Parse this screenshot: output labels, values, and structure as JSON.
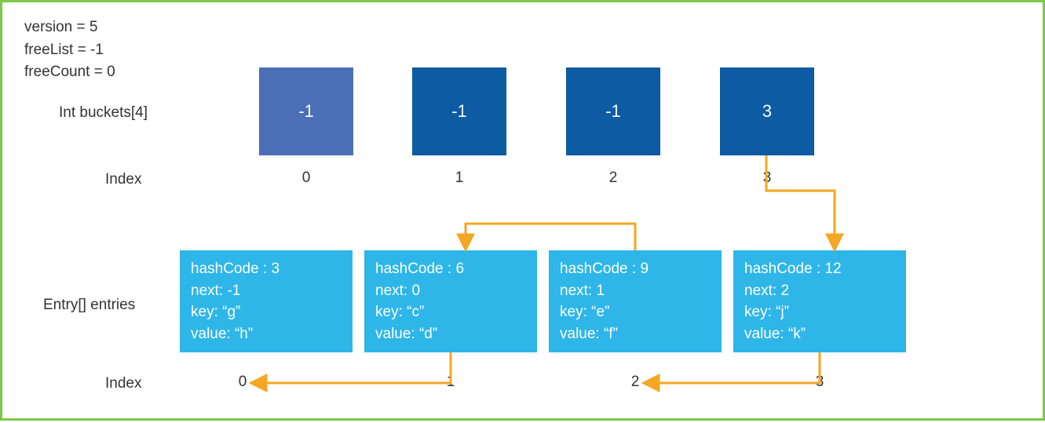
{
  "state": {
    "version": "version = 5",
    "freeList": "freeList = -1",
    "freeCount": "freeCount = 0"
  },
  "labels": {
    "buckets": "Int buckets[4]",
    "entries": "Entry[] entries",
    "index": "Index"
  },
  "hash": "hashCode : ",
  "next": "next: ",
  "key": "key: ",
  "value": "value: ",
  "buckets": [
    {
      "v": "-1"
    },
    {
      "v": "-1"
    },
    {
      "v": "-1"
    },
    {
      "v": "3"
    }
  ],
  "bucketIndex": [
    "0",
    "1",
    "2",
    "3"
  ],
  "entries": [
    {
      "hash": "3",
      "next": "-1",
      "key": "“g”",
      "value": "“h”"
    },
    {
      "hash": "6",
      "next": "0",
      "key": "“c”",
      "value": "“d”"
    },
    {
      "hash": "9",
      "next": "1",
      "key": "“e”",
      "value": "“f”"
    },
    {
      "hash": "12",
      "next": "2",
      "key": "“j”",
      "value": "“k”"
    }
  ],
  "entryIndex": [
    "0",
    "1",
    "2",
    "3"
  ]
}
